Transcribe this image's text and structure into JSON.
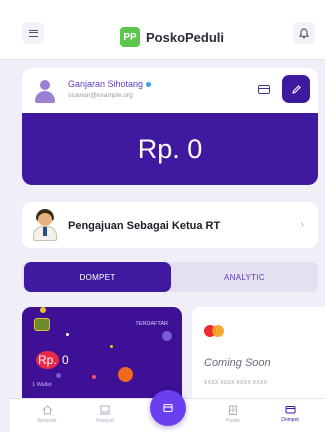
{
  "app": {
    "name": "PoskoPeduli",
    "logo_text": "PP"
  },
  "profile": {
    "name": "Ganjaran Sihotang",
    "email": "ocawan@example.org",
    "balance": "Rp. 0"
  },
  "rt_card": {
    "label": "Pengajuan Sebagai Ketua RT",
    "chevron": "›"
  },
  "tabs": [
    {
      "label": "DOMPET"
    },
    {
      "label": "ANALYTIC"
    }
  ],
  "wallet": {
    "status": "TERDAFTAR",
    "amount_prefix": "Rp.",
    "amount": "0",
    "sub": "1 Wallet"
  },
  "coming_soon": {
    "text": "Coming Soon",
    "number": "XXXX XXXX XXXX XXXX"
  },
  "bottom_nav": [
    {
      "label": "Beranda"
    },
    {
      "label": "Riwayat"
    },
    {
      "label": "Posko"
    },
    {
      "label": "Dompet"
    }
  ],
  "colors": {
    "primary": "#3f1aa0",
    "accent": "#6a3ff0",
    "logo": "#5cc64a"
  }
}
